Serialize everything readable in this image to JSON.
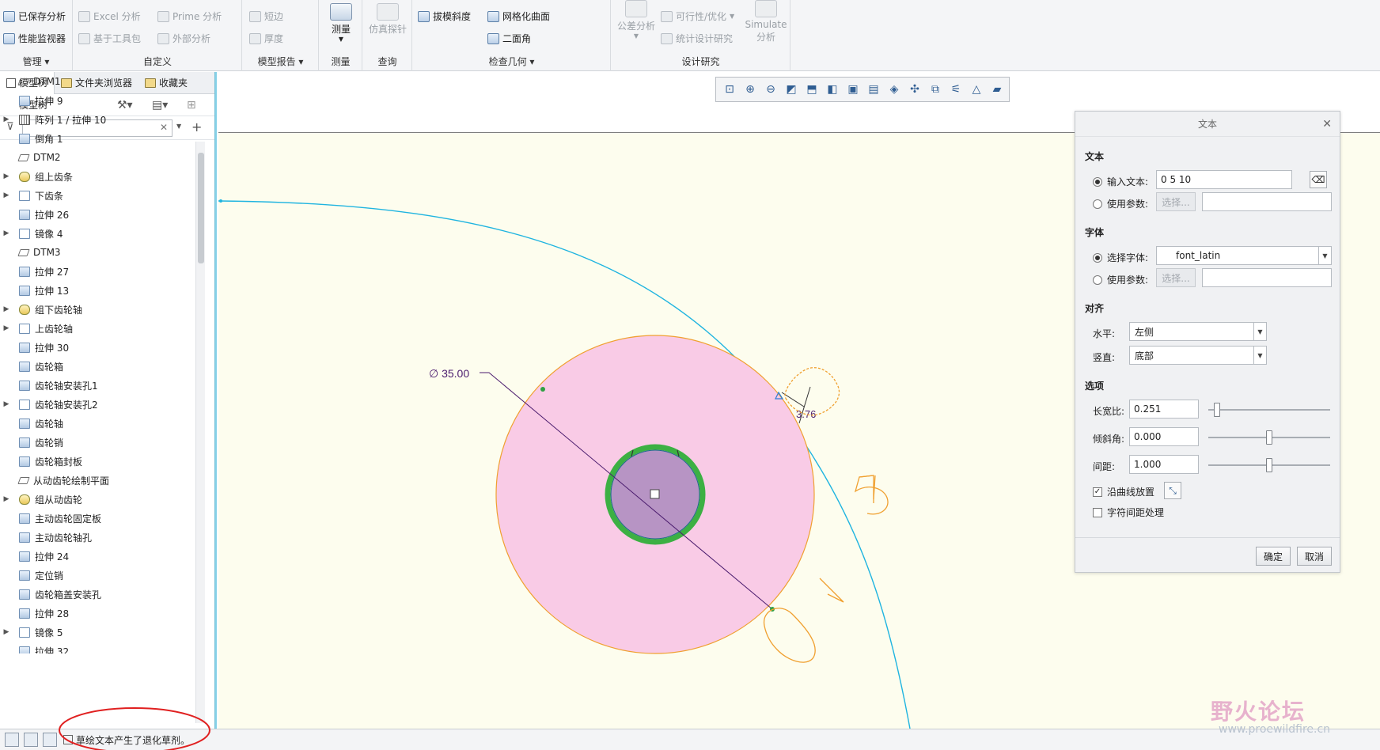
{
  "ribbon": {
    "groups": [
      {
        "label": "管理",
        "buttons": [
          "已保存分析",
          "性能监视器"
        ]
      },
      {
        "label": "自定义",
        "buttons": [
          "Excel 分析",
          "Prime 分析",
          "基于工具包",
          "外部分析"
        ]
      },
      {
        "label": "模型报告",
        "buttons": [
          "短边",
          "厚度"
        ]
      },
      {
        "label": "测量",
        "buttons": [
          "测量"
        ]
      },
      {
        "label": "查询",
        "buttons": [
          "仿真探针"
        ]
      },
      {
        "label": "检查几何",
        "buttons": [
          "拔模斜度",
          "网格化曲面",
          "二面角"
        ]
      },
      {
        "label": "设计研究",
        "buttons": [
          "公差分析",
          "可行性/优化",
          "统计设计研究",
          "Simulate",
          "分析"
        ]
      }
    ]
  },
  "left_panel": {
    "tabs": [
      "模型树",
      "文件夹浏览器",
      "收藏夹"
    ],
    "tree_title": "模型树",
    "filter_placeholder": "",
    "items": [
      {
        "label": "DTM1",
        "icon": "plane",
        "expand": false
      },
      {
        "label": "拉伸 9",
        "icon": "extrude",
        "expand": false
      },
      {
        "label": "阵列 1 / 拉伸 10",
        "icon": "pattern",
        "expand": true
      },
      {
        "label": "倒角 1",
        "icon": "chamfer",
        "expand": false
      },
      {
        "label": "DTM2",
        "icon": "plane",
        "expand": false
      },
      {
        "label": "组上齿条",
        "icon": "group",
        "expand": true
      },
      {
        "label": "下齿条",
        "icon": "mirror",
        "expand": true
      },
      {
        "label": "拉伸 26",
        "icon": "extrude",
        "expand": false
      },
      {
        "label": "镜像 4",
        "icon": "mirror",
        "expand": true
      },
      {
        "label": "DTM3",
        "icon": "plane",
        "expand": false
      },
      {
        "label": "拉伸 27",
        "icon": "extrude",
        "expand": false
      },
      {
        "label": "拉伸 13",
        "icon": "extrude",
        "expand": false
      },
      {
        "label": "组下齿轮轴",
        "icon": "group",
        "expand": true
      },
      {
        "label": "上齿轮轴",
        "icon": "mirror",
        "expand": true
      },
      {
        "label": "拉伸 30",
        "icon": "extrude",
        "expand": false
      },
      {
        "label": "齿轮箱",
        "icon": "extrude",
        "expand": false
      },
      {
        "label": "齿轮轴安装孔1",
        "icon": "extrude",
        "expand": false
      },
      {
        "label": "齿轮轴安装孔2",
        "icon": "mirror",
        "expand": true
      },
      {
        "label": "齿轮轴",
        "icon": "extrude",
        "expand": false
      },
      {
        "label": "齿轮销",
        "icon": "extrude",
        "expand": false
      },
      {
        "label": "齿轮箱封板",
        "icon": "extrude",
        "expand": false
      },
      {
        "label": "从动齿轮绘制平面",
        "icon": "plane",
        "expand": false
      },
      {
        "label": "组从动齿轮",
        "icon": "group",
        "expand": true
      },
      {
        "label": "主动齿轮固定板",
        "icon": "extrude",
        "expand": false
      },
      {
        "label": "主动齿轮轴孔",
        "icon": "extrude",
        "expand": false
      },
      {
        "label": "拉伸 24",
        "icon": "extrude",
        "expand": false
      },
      {
        "label": "定位销",
        "icon": "extrude",
        "expand": false
      },
      {
        "label": "齿轮箱盖安装孔",
        "icon": "extrude",
        "expand": false
      },
      {
        "label": "拉伸 28",
        "icon": "extrude",
        "expand": false
      },
      {
        "label": "镜像 5",
        "icon": "mirror",
        "expand": true
      },
      {
        "label": "拉伸 32",
        "icon": "extrude",
        "expand": false
      }
    ]
  },
  "canvas": {
    "dimension_label": "∅ 35.00",
    "small_dimension": "3.76",
    "colors": {
      "background": "#fdfdee",
      "disk_fill": "#f9cbe6",
      "disk_edge": "#f0a030",
      "hub_fill": "#b794c4",
      "ring": "#3cb043",
      "curve": "#1fb4e0",
      "dimension_line": "#4b1c6e"
    }
  },
  "dialog": {
    "title": "文本",
    "section_text": "文本",
    "input_text_label": "输入文本:",
    "input_text_value": "0 5 10",
    "use_param_label": "使用参数:",
    "select_btn": "选择...",
    "section_font": "字体",
    "select_font_label": "选择字体:",
    "font_value": "font_latin",
    "use_param_label2": "使用参数:",
    "select_btn2": "选择...",
    "section_align": "对齐",
    "horizontal_label": "水平:",
    "horizontal_value": "左侧",
    "vertical_label": "竖直:",
    "vertical_value": "底部",
    "section_options": "选项",
    "aspect_label": "长宽比:",
    "aspect_value": "0.251",
    "aspect_level": 0.05,
    "slant_label": "倾斜角:",
    "slant_value": "0.000",
    "slant_level": 0.5,
    "spacing_label": "间距:",
    "spacing_value": "1.000",
    "spacing_level": 0.5,
    "along_curve_label": "沿曲线放置",
    "char_spacing_label": "字符间距处理",
    "ok": "确定",
    "cancel": "取消"
  },
  "status": {
    "message": "草绘文本产生了退化草剂。"
  },
  "watermark": {
    "title": "野火论坛",
    "url": "www.proewildfire.cn"
  }
}
